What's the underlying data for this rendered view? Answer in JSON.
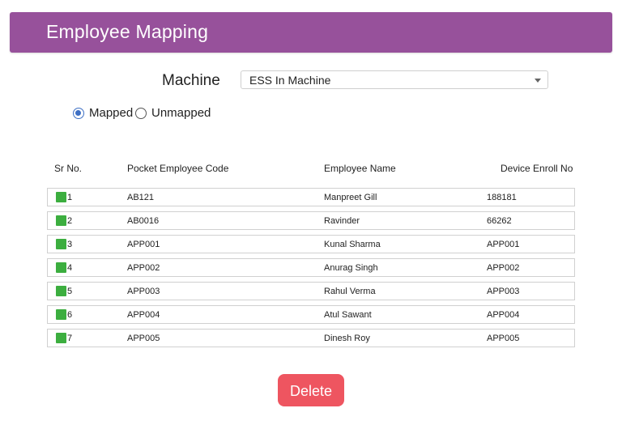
{
  "header": {
    "title": "Employee Mapping",
    "color": "#97519b"
  },
  "form": {
    "machine_label": "Machine",
    "machine_select": {
      "value": "ESS In Machine"
    },
    "radio": {
      "mapped": "Mapped",
      "unmapped": "Unmapped",
      "selected": "Mapped"
    }
  },
  "table": {
    "headers": [
      "Sr No.",
      "Pocket Employee Code",
      "Employee Name",
      "Device Enroll No"
    ],
    "rows": [
      {
        "sr": "1",
        "code": "AB121",
        "name": "Manpreet Gill",
        "enroll": "188181"
      },
      {
        "sr": "2",
        "code": "AB0016",
        "name": "Ravinder",
        "enroll": "66262"
      },
      {
        "sr": "3",
        "code": "APP001",
        "name": "Kunal Sharma",
        "enroll": "APP001"
      },
      {
        "sr": "4",
        "code": "APP002",
        "name": "Anurag Singh",
        "enroll": "APP002"
      },
      {
        "sr": "5",
        "code": "APP003",
        "name": "Rahul Verma",
        "enroll": "APP003"
      },
      {
        "sr": "6",
        "code": "APP004",
        "name": "Atul Sawant",
        "enroll": "APP004"
      },
      {
        "sr": "7",
        "code": "APP005",
        "name": "Dinesh Roy",
        "enroll": "APP005"
      }
    ]
  },
  "actions": {
    "delete_label": "Delete",
    "delete_color": "#ee5560"
  }
}
